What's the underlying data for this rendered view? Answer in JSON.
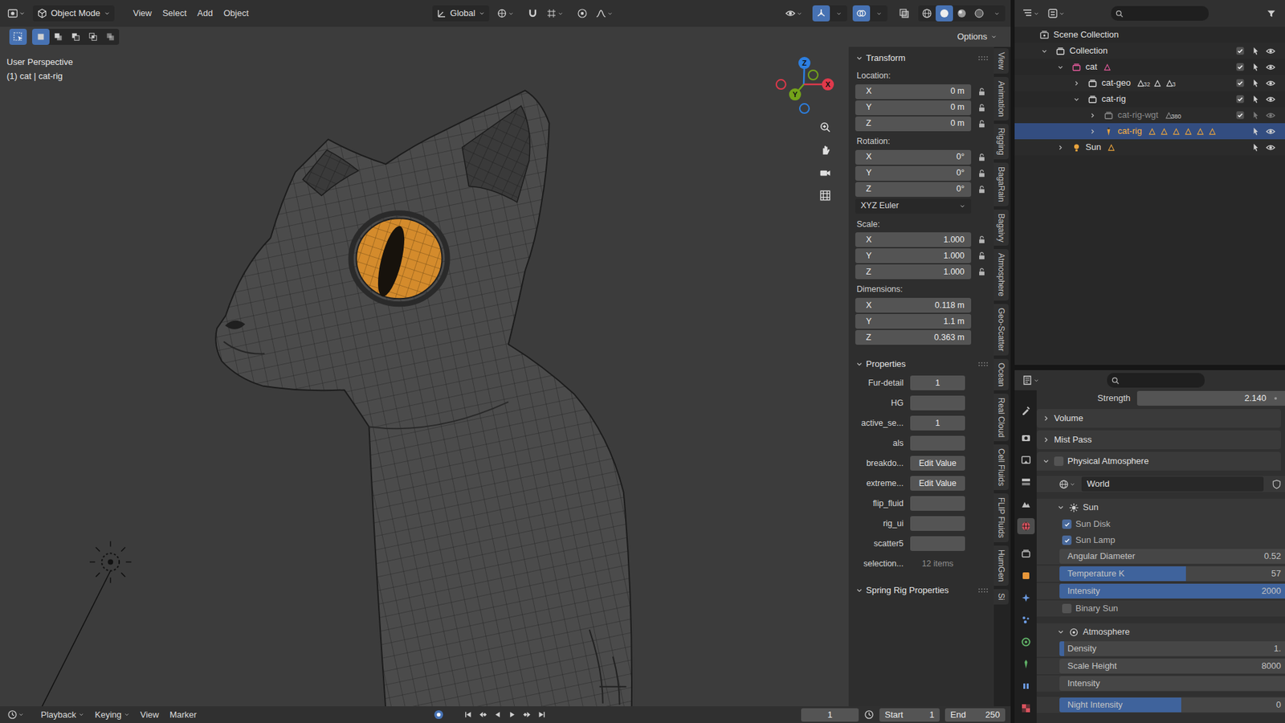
{
  "header": {
    "mode": "Object Mode",
    "menus": [
      "View",
      "Select",
      "Add",
      "Object"
    ],
    "orientation": "Global",
    "snap": false,
    "proportional": false,
    "gizmos": true,
    "overlays": true,
    "xray": false,
    "shading": [
      {
        "selected": false
      },
      {
        "selected": true
      },
      {
        "selected": false
      },
      {
        "selected": false
      }
    ]
  },
  "tool_settings": {
    "tool_selected": true,
    "select_modes": [
      {
        "selected": true
      },
      {
        "selected": false
      },
      {
        "selected": false
      },
      {
        "selected": false
      },
      {
        "selected": false
      }
    ],
    "options": "Options"
  },
  "viewport": {
    "perspective": "User Perspective",
    "object_info": "(1) cat | cat-rig",
    "axes": [
      {
        "label": "Z",
        "color": "#2d7fe0"
      },
      {
        "label": "X",
        "color": "#e0394b"
      },
      {
        "label": "Y",
        "color": "#74a31a"
      }
    ]
  },
  "sidebar": {
    "transform": {
      "title": "Transform",
      "expanded": true,
      "groups": [
        {
          "label": "Location:",
          "fields": [
            {
              "axis": "X",
              "value": "0 m",
              "locked": false
            },
            {
              "axis": "Y",
              "value": "0 m",
              "locked": false
            },
            {
              "axis": "Z",
              "value": "0 m",
              "locked": false
            }
          ]
        },
        {
          "label": "Rotation:",
          "fields": [
            {
              "axis": "X",
              "value": "0°",
              "locked": false
            },
            {
              "axis": "Y",
              "value": "0°",
              "locked": false
            },
            {
              "axis": "Z",
              "value": "0°",
              "locked": false
            }
          ],
          "mode": "XYZ Euler"
        },
        {
          "label": "Scale:",
          "fields": [
            {
              "axis": "X",
              "value": "1.000",
              "locked": false
            },
            {
              "axis": "Y",
              "value": "1.000",
              "locked": false
            },
            {
              "axis": "Z",
              "value": "1.000",
              "locked": false
            }
          ]
        },
        {
          "label": "Dimensions:",
          "fields": [
            {
              "axis": "X",
              "value": "0.118 m"
            },
            {
              "axis": "Y",
              "value": "1.1 m"
            },
            {
              "axis": "Z",
              "value": "0.363 m"
            }
          ]
        }
      ]
    },
    "properties": {
      "title": "Properties",
      "expanded": true,
      "items": [
        {
          "label": "Fur-detail",
          "kind": "value",
          "value": "1"
        },
        {
          "label": "HG",
          "kind": "value",
          "value": ""
        },
        {
          "label": "active_se...",
          "kind": "value",
          "value": "1"
        },
        {
          "label": "als",
          "kind": "value",
          "value": ""
        },
        {
          "label": "breakdo...",
          "kind": "button",
          "value": "Edit Value"
        },
        {
          "label": "extreme...",
          "kind": "button",
          "value": "Edit Value"
        },
        {
          "label": "flip_fluid",
          "kind": "value",
          "value": ""
        },
        {
          "label": "rig_ui",
          "kind": "value",
          "value": ""
        },
        {
          "label": "scatter5",
          "kind": "value",
          "value": ""
        },
        {
          "label": "selection...",
          "kind": "text",
          "value": "12 items"
        }
      ]
    },
    "spring": {
      "title": "Spring Rig Properties",
      "expanded": true
    },
    "tabs": [
      "View",
      "Animation",
      "Rigging",
      "BagaRain",
      "Bagaivy",
      "Atmosphere",
      "Geo-Scatter",
      "Ocean",
      "Real Cloud",
      "Cell Fluids",
      "FLIP Fluids",
      "HumGen",
      "Si"
    ]
  },
  "outliner": {
    "rows": [
      {
        "name": "Scene Collection",
        "depth": 0,
        "toggle": "none",
        "kind": "scene",
        "color": "#d6d6d6",
        "selected": false,
        "active": false,
        "dimmed": false,
        "extras": []
      },
      {
        "name": "Collection",
        "depth": 1,
        "toggle": "open",
        "kind": "collection",
        "checked": true,
        "color": "#d6d6d6",
        "selected": false,
        "active": false,
        "dimmed": false,
        "extras": []
      },
      {
        "name": "cat",
        "depth": 2,
        "toggle": "open",
        "kind": "collection",
        "checked": true,
        "color": "#e35a9b",
        "selected": false,
        "active": false,
        "dimmed": false,
        "extras": [
          ""
        ]
      },
      {
        "name": "cat-geo",
        "depth": 3,
        "toggle": "closed",
        "kind": "collection",
        "checked": true,
        "color": "#d6d6d6",
        "selected": false,
        "active": false,
        "dimmed": false,
        "extras": [
          "32",
          "",
          "3"
        ]
      },
      {
        "name": "cat-rig",
        "depth": 3,
        "toggle": "open",
        "kind": "collection",
        "checked": true,
        "color": "#d6d6d6",
        "selected": false,
        "active": false,
        "dimmed": false,
        "extras": []
      },
      {
        "name": "cat-rig-wgt",
        "depth": 4,
        "toggle": "closed",
        "kind": "collection",
        "checked": true,
        "color": "#8a8a8a",
        "selected": false,
        "active": false,
        "dimmed": true,
        "extras": [
          "380"
        ]
      },
      {
        "name": "cat-rig",
        "depth": 4,
        "toggle": "closed",
        "kind": "armature",
        "color": "#e8a33d",
        "selected": true,
        "active": true,
        "dimmed": false,
        "extras": [
          "",
          "",
          "",
          "",
          "",
          ""
        ]
      },
      {
        "name": "Sun",
        "depth": 2,
        "toggle": "closed",
        "kind": "light",
        "color": "#e8a33d",
        "selected": false,
        "active": false,
        "dimmed": false,
        "extras": [
          ""
        ]
      }
    ]
  },
  "properties_editor": {
    "tabs": [
      {
        "selected": false,
        "color": "#bdbdbd"
      },
      {
        "selected": false,
        "color": "#bdbdbd"
      },
      {
        "selected": false,
        "color": "#bdbdbd"
      },
      {
        "selected": false,
        "color": "#bdbdbd"
      },
      {
        "selected": false,
        "color": "#bdbdbd"
      },
      {
        "selected": true,
        "color": "#d9525e"
      },
      {
        "selected": false,
        "color": "#bdbdbd"
      },
      {
        "selected": false,
        "color": "#e8973a"
      },
      {
        "selected": false,
        "color": "#6b9ae0"
      },
      {
        "selected": false,
        "color": "#6b9ae0"
      },
      {
        "selected": false,
        "color": "#5fb066"
      },
      {
        "selected": false,
        "color": "#5fb066"
      },
      {
        "selected": false,
        "color": "#6b9ae0"
      },
      {
        "selected": false,
        "color": "#d9525e"
      }
    ],
    "rows": [
      {
        "kind": "value",
        "label": "Strength",
        "value": "2.140"
      },
      {
        "kind": "panel",
        "label": "Volume",
        "expanded": false
      },
      {
        "kind": "panel",
        "label": "Mist Pass",
        "expanded": false
      },
      {
        "kind": "panel_check",
        "label": "Physical Atmosphere",
        "expanded": true,
        "checked": false
      },
      {
        "kind": "datablock",
        "value": "World"
      },
      {
        "kind": "subpanel",
        "label": "Sun",
        "expanded": true
      },
      {
        "kind": "checkbox",
        "label": "Sun Disk",
        "checked": true
      },
      {
        "kind": "checkbox",
        "label": "Sun Lamp",
        "checked": true
      },
      {
        "kind": "slider",
        "label": "Angular Diameter",
        "value": "0.52",
        "level": 0
      },
      {
        "kind": "slider",
        "label": "Temperature K",
        "value": "57",
        "level": 0.56
      },
      {
        "kind": "slider",
        "label": "Intensity",
        "value": "2000",
        "level": 1
      },
      {
        "kind": "checkbox",
        "label": "Binary Sun",
        "checked": false
      },
      {
        "kind": "subpanel",
        "label": "Atmosphere",
        "expanded": true
      },
      {
        "kind": "slider",
        "label": "Density",
        "value": "1.",
        "level": 0.02
      },
      {
        "kind": "slider",
        "label": "Scale Height",
        "value": "8000",
        "level": 0
      },
      {
        "kind": "slider",
        "label": "Intensity",
        "value": "",
        "level": 0
      },
      {
        "kind": "slider",
        "label": "Night Intensity",
        "value": "0",
        "level": 0.54
      }
    ]
  },
  "timeline": {
    "menus": [
      {
        "label": "Playback",
        "dropdown": true
      },
      {
        "label": "Keying",
        "dropdown": true
      },
      {
        "label": "View",
        "dropdown": false
      },
      {
        "label": "Marker",
        "dropdown": false
      }
    ],
    "frame": "1",
    "start_label": "Start",
    "start": "1",
    "end_label": "End",
    "end": "250"
  }
}
